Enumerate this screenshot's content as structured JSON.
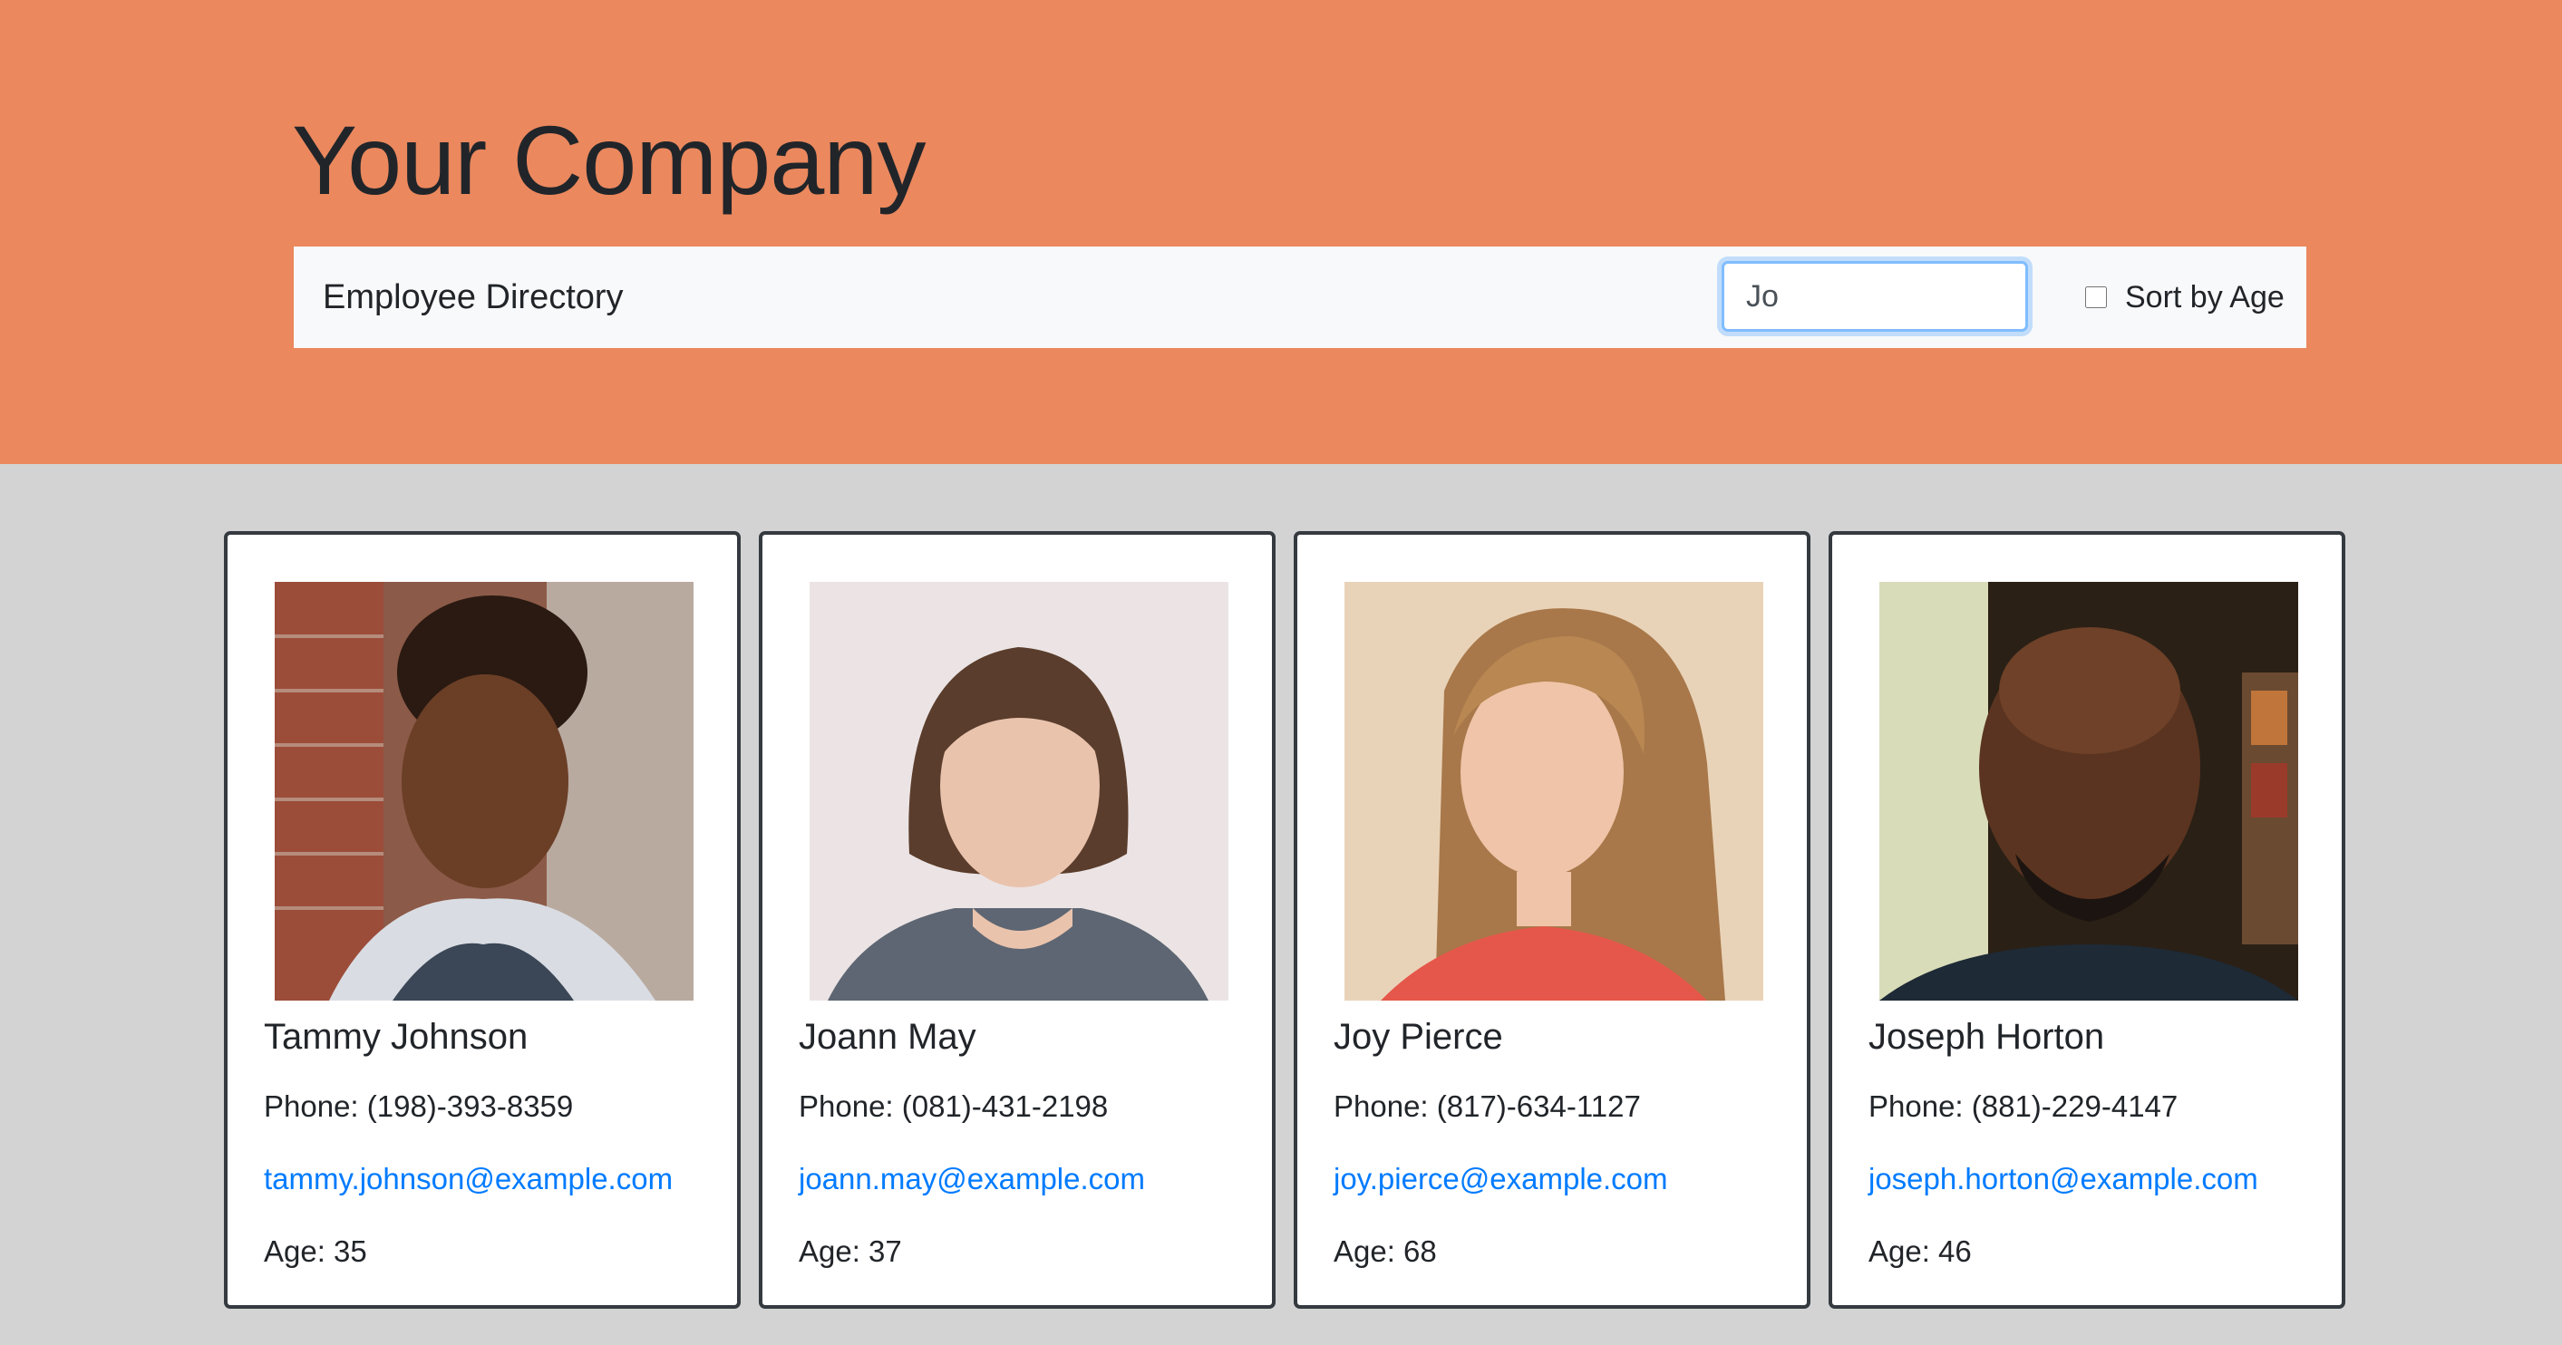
{
  "header": {
    "title": "Your Company",
    "nav_brand": "Employee Directory",
    "search": {
      "value": "Jo",
      "placeholder": ""
    },
    "sort_label": "Sort by Age",
    "sort_checked": false
  },
  "colors": {
    "hero_bg": "#eb885e",
    "page_bg": "#d3d3d3",
    "link": "#007bff",
    "card_border": "#343a40"
  },
  "employees": [
    {
      "name": "Tammy Johnson",
      "phone": "Phone: (198)-393-8359",
      "email": "tammy.johnson@example.com",
      "age": "Age: 35",
      "photo": "employee-photo"
    },
    {
      "name": "Joann May",
      "phone": "Phone: (081)-431-2198",
      "email": "joann.may@example.com",
      "age": "Age: 37",
      "photo": "employee-photo"
    },
    {
      "name": "Joy Pierce",
      "phone": "Phone: (817)-634-1127",
      "email": "joy.pierce@example.com",
      "age": "Age: 68",
      "photo": "employee-photo"
    },
    {
      "name": "Joseph Horton",
      "phone": "Phone: (881)-229-4147",
      "email": "joseph.horton@example.com",
      "age": "Age: 46",
      "photo": "employee-photo"
    }
  ]
}
